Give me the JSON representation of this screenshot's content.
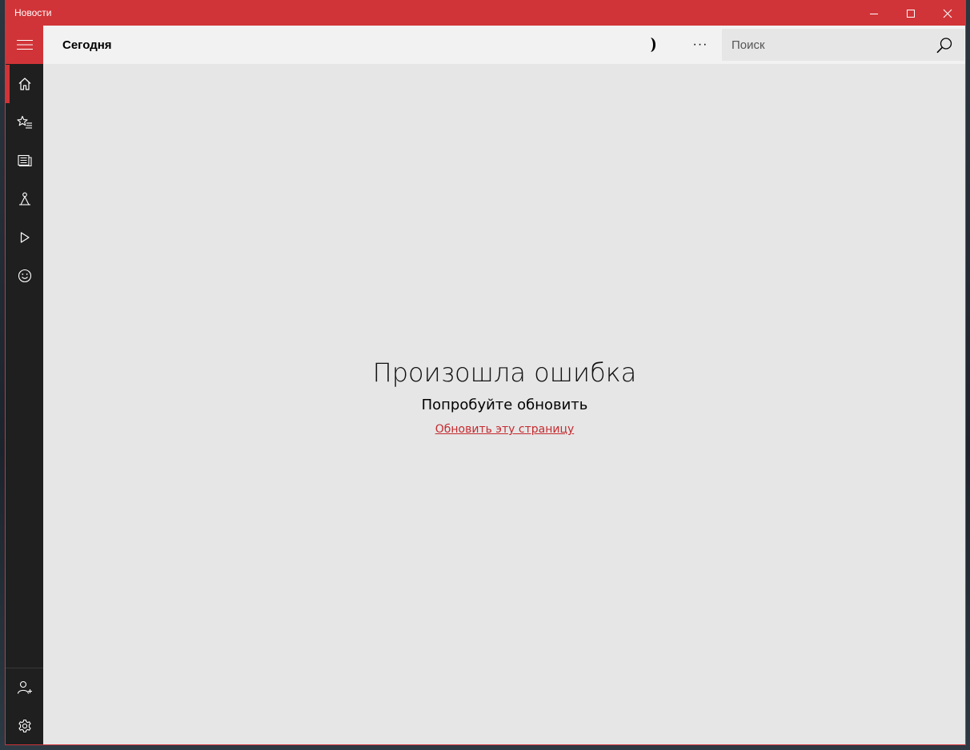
{
  "window": {
    "title": "Новости",
    "buttons": {
      "minimize_icon": "minimize-icon",
      "maximize_icon": "maximize-icon",
      "close_icon": "close-icon"
    }
  },
  "colors": {
    "accent": "#d13438",
    "sidebar_bg": "#1f1f1f",
    "topbar_bg": "#f2f2f2",
    "content_bg": "#e6e6e6",
    "link": "#c42b30"
  },
  "sidebar": {
    "menu_icon": "hamburger-icon",
    "items": [
      {
        "icon": "home-icon",
        "active": true
      },
      {
        "icon": "favorites-icon",
        "active": false
      },
      {
        "icon": "news-icon",
        "active": false
      },
      {
        "icon": "local-icon",
        "active": false
      },
      {
        "icon": "video-icon",
        "active": false
      },
      {
        "icon": "emoji-icon",
        "active": false
      }
    ],
    "bottom_items": [
      {
        "icon": "add-account-icon"
      },
      {
        "icon": "settings-icon"
      }
    ]
  },
  "header": {
    "page_title": "Сегодня",
    "more_label": "···",
    "search": {
      "placeholder": "Поиск",
      "value": ""
    }
  },
  "main": {
    "error_title": "Произошла ошибка",
    "error_subtitle": "Попробуйте обновить",
    "refresh_link": "Обновить эту страницу"
  }
}
